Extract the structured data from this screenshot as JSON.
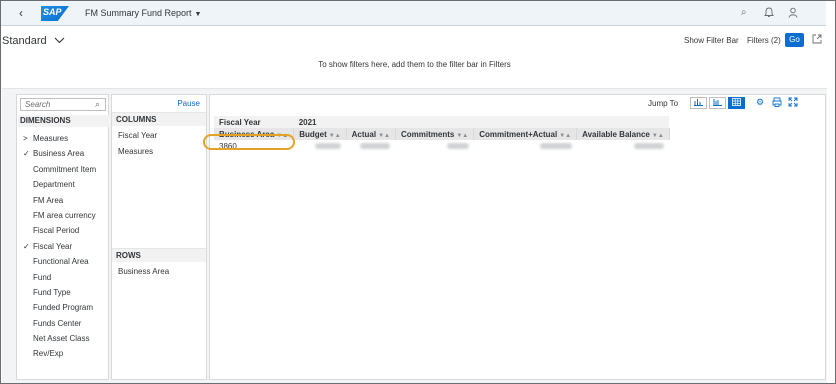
{
  "shell": {
    "app_title": "FM Summary Fund Report",
    "logo_text": "SAP"
  },
  "variant": {
    "name": "Standard"
  },
  "filterbar": {
    "show_filter_bar": "Show Filter Bar",
    "filters": "Filters (2)",
    "go": "Go",
    "hint": "To show filters here, add them to the filter bar in Filters"
  },
  "dimensions": {
    "search_placeholder": "Search",
    "header": "DIMENSIONS",
    "items": [
      {
        "label": "Measures",
        "mark": ">"
      },
      {
        "label": "Business Area",
        "mark": "✓"
      },
      {
        "label": "Commitment Item",
        "mark": ""
      },
      {
        "label": "Department",
        "mark": ""
      },
      {
        "label": "FM Area",
        "mark": ""
      },
      {
        "label": "FM area currency",
        "mark": ""
      },
      {
        "label": "Fiscal Period",
        "mark": ""
      },
      {
        "label": "Fiscal Year",
        "mark": "✓"
      },
      {
        "label": "Functional Area",
        "mark": ""
      },
      {
        "label": "Fund",
        "mark": ""
      },
      {
        "label": "Fund Type",
        "mark": ""
      },
      {
        "label": "Funded Program",
        "mark": ""
      },
      {
        "label": "Funds Center",
        "mark": ""
      },
      {
        "label": "Net Asset Class",
        "mark": ""
      },
      {
        "label": "Rev/Exp",
        "mark": ""
      }
    ]
  },
  "layout_panel": {
    "pause": "Pause",
    "columns_header": "COLUMNS",
    "columns": [
      "Fiscal Year",
      "Measures"
    ],
    "rows_header": "ROWS",
    "rows": [
      "Business Area"
    ]
  },
  "grid": {
    "jump_to": "Jump To",
    "fiscal_year_label": "Fiscal Year",
    "fiscal_year_value": "2021",
    "row_header": "Business Area",
    "columns": [
      "Budget",
      "Actual",
      "Commitments",
      "Commitment+Actual",
      "Available Balance"
    ],
    "row_value": "3860"
  },
  "colors": {
    "accent": "#0a6ed1",
    "highlight": "#e4a327"
  }
}
